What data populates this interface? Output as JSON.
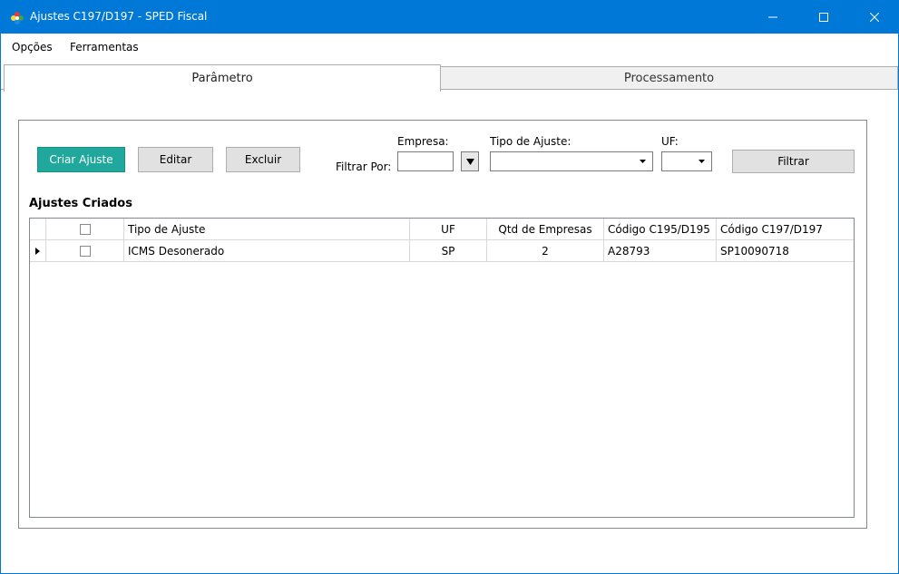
{
  "window": {
    "title": "Ajustes C197/D197 - SPED Fiscal"
  },
  "menu": {
    "options": "Opções",
    "tools": "Ferramentas"
  },
  "tabs": {
    "params": "Parâmetro",
    "processing": "Processamento"
  },
  "toolbar": {
    "create": "Criar Ajuste",
    "edit": "Editar",
    "delete": "Excluir",
    "filter_by": "Filtrar Por:",
    "company_label": "Empresa:",
    "company_value": "",
    "adjust_type_label": "Tipo de Ajuste:",
    "adjust_type_value": "",
    "uf_label": "UF:",
    "uf_value": "",
    "filter": "Filtrar"
  },
  "section_title": "Ajustes Criados",
  "grid": {
    "columns": [
      "",
      "Tipo de Ajuste",
      "UF",
      "Qtd de Empresas",
      "Código C195/D195",
      "Código C197/D197"
    ],
    "rows": [
      {
        "checked": false,
        "tipo": "ICMS Desonerado",
        "uf": "SP",
        "qtd": "2",
        "c195": "A28793",
        "c197": "SP10090718"
      }
    ]
  },
  "colors": {
    "titlebar": "#0078d7",
    "primary_button": "#20a89c"
  }
}
